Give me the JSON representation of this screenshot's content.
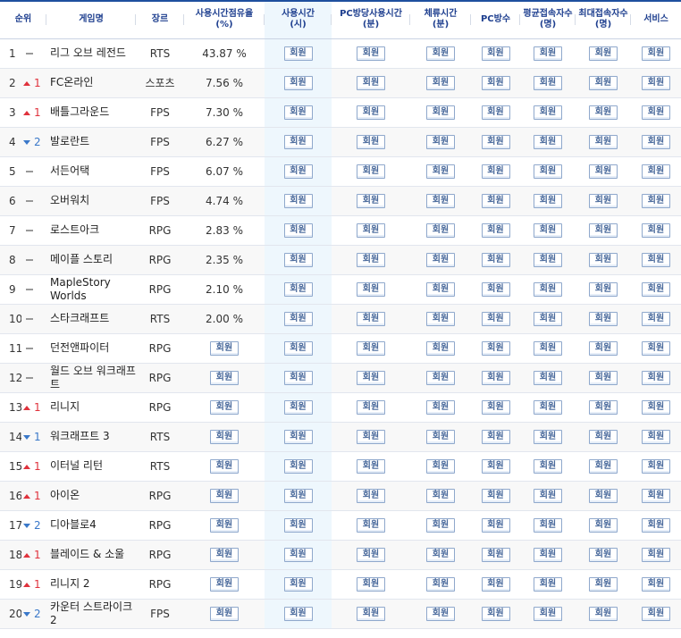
{
  "headers": {
    "rank": "순위",
    "name": "게임명",
    "genre": "장르",
    "share_l1": "사용시간점유율",
    "share_l2": "(%)",
    "time_l1": "사용시간",
    "time_l2": "(시)",
    "pctime_l1": "PC방당사용시간",
    "pctime_l2": "(분)",
    "stay_l1": "체류시간",
    "stay_l2": "(분)",
    "pccount": "PC방수",
    "avgconn_l1": "평균접속자수",
    "avgconn_l2": "(명)",
    "maxconn_l1": "최대접속자수",
    "maxconn_l2": "(명)",
    "service": "서비스"
  },
  "member_label": "회원",
  "colors": {
    "header_text": "#1e3f8f",
    "up": "#e0323c",
    "down": "#3a78c9",
    "time_col_bg": "#eef7fd"
  },
  "rows": [
    {
      "rank": "1",
      "dir": "same",
      "delta": "",
      "name": "리그 오브 레전드",
      "genre": "RTS",
      "share": "43.87 %"
    },
    {
      "rank": "2",
      "dir": "up",
      "delta": "1",
      "name": "FC온라인",
      "genre": "스포츠",
      "share": "7.56 %"
    },
    {
      "rank": "3",
      "dir": "up",
      "delta": "1",
      "name": "배틀그라운드",
      "genre": "FPS",
      "share": "7.30 %"
    },
    {
      "rank": "4",
      "dir": "down",
      "delta": "2",
      "name": "발로란트",
      "genre": "FPS",
      "share": "6.27 %"
    },
    {
      "rank": "5",
      "dir": "same",
      "delta": "",
      "name": "서든어택",
      "genre": "FPS",
      "share": "6.07 %"
    },
    {
      "rank": "6",
      "dir": "same",
      "delta": "",
      "name": "오버워치",
      "genre": "FPS",
      "share": "4.74 %"
    },
    {
      "rank": "7",
      "dir": "same",
      "delta": "",
      "name": "로스트아크",
      "genre": "RPG",
      "share": "2.83 %"
    },
    {
      "rank": "8",
      "dir": "same",
      "delta": "",
      "name": "메이플 스토리",
      "genre": "RPG",
      "share": "2.35 %"
    },
    {
      "rank": "9",
      "dir": "same",
      "delta": "",
      "name": "MapleStory Worlds",
      "genre": "RPG",
      "share": "2.10 %"
    },
    {
      "rank": "10",
      "dir": "same",
      "delta": "",
      "name": "스타크래프트",
      "genre": "RTS",
      "share": "2.00 %"
    },
    {
      "rank": "11",
      "dir": "same",
      "delta": "",
      "name": "던전앤파이터",
      "genre": "RPG",
      "share": null
    },
    {
      "rank": "12",
      "dir": "same",
      "delta": "",
      "name": "월드 오브 워크래프트",
      "genre": "RPG",
      "share": null
    },
    {
      "rank": "13",
      "dir": "up",
      "delta": "1",
      "name": "리니지",
      "genre": "RPG",
      "share": null
    },
    {
      "rank": "14",
      "dir": "down",
      "delta": "1",
      "name": "워크래프트 3",
      "genre": "RTS",
      "share": null
    },
    {
      "rank": "15",
      "dir": "up",
      "delta": "1",
      "name": "이터널 리턴",
      "genre": "RTS",
      "share": null
    },
    {
      "rank": "16",
      "dir": "up",
      "delta": "1",
      "name": "아이온",
      "genre": "RPG",
      "share": null
    },
    {
      "rank": "17",
      "dir": "down",
      "delta": "2",
      "name": "디아블로4",
      "genre": "RPG",
      "share": null
    },
    {
      "rank": "18",
      "dir": "up",
      "delta": "1",
      "name": "블레이드 & 소울",
      "genre": "RPG",
      "share": null
    },
    {
      "rank": "19",
      "dir": "up",
      "delta": "1",
      "name": "리니지 2",
      "genre": "RPG",
      "share": null
    },
    {
      "rank": "20",
      "dir": "down",
      "delta": "2",
      "name": "카운터 스트라이크 2",
      "genre": "FPS",
      "share": null
    }
  ]
}
